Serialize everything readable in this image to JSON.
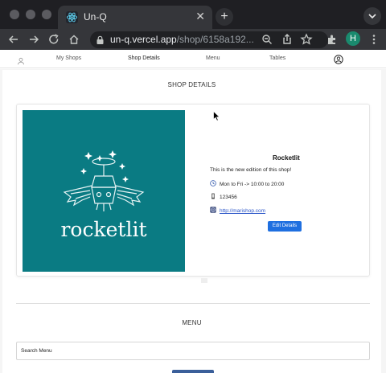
{
  "browser": {
    "tab_title": "Un-Q",
    "tab_close": "✕",
    "new_tab": "+",
    "url_host": "un-q.vercel.app",
    "url_path": "/shop/6158a192...",
    "profile_initial": "H"
  },
  "navbar": {
    "items": [
      "My Shops",
      "Shop Details",
      "Menu",
      "Tables"
    ],
    "active": "Shop Details"
  },
  "shop_details": {
    "section_title": "SHOP DETAILS",
    "logo_text": "rocketlit",
    "name": "Rocketlit",
    "description": "This is the new edition of this shop!",
    "hours": "Mon to Fri -> 10:00 to 20:00",
    "phone": "123456",
    "website": "http://marishop.com",
    "edit_label": "Edit Details"
  },
  "menu": {
    "section_title": "MENU",
    "search_placeholder": "Search Menu"
  },
  "colors": {
    "brand_teal": "#0a7b83",
    "button_blue": "#1f6fe0",
    "link_blue": "#2a55c8"
  },
  "icons": [
    "react-icon",
    "back-icon",
    "forward-icon",
    "reload-icon",
    "home-icon",
    "lock-icon",
    "zoom-icon",
    "share-icon",
    "star-icon",
    "extensions-icon",
    "menu-icon",
    "user-circle-icon",
    "clock-icon",
    "phone-icon",
    "globe-icon"
  ]
}
